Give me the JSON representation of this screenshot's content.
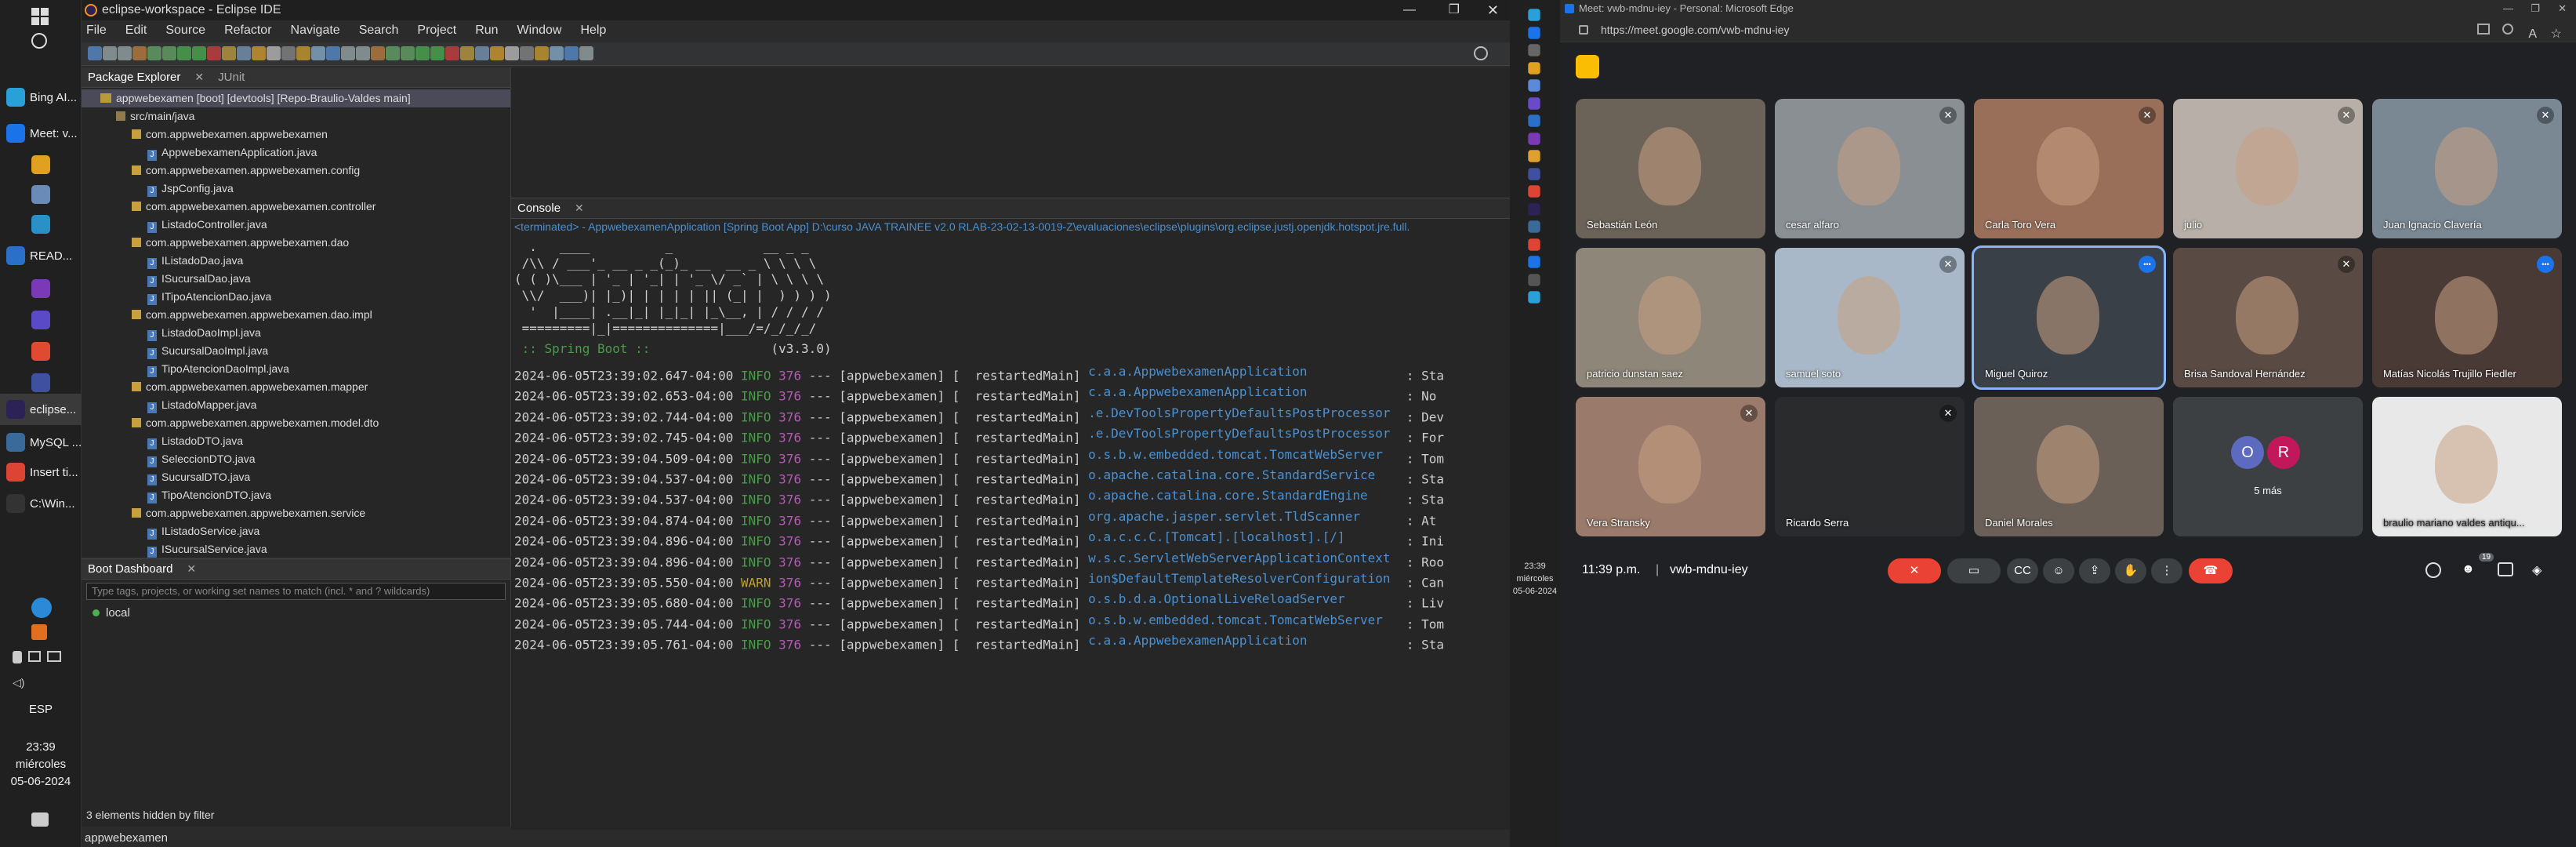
{
  "taskbar": {
    "items": [
      {
        "label": "Bing AI...",
        "color": "#2aa0d8"
      },
      {
        "label": "Meet: v...",
        "color": "#1a73e8"
      },
      {
        "label": "",
        "color": "#e0a020"
      },
      {
        "label": "",
        "color": "#6a8ab8"
      },
      {
        "label": "",
        "color": "#2a90c8"
      },
      {
        "label": "READ...",
        "color": "#2a70c8"
      },
      {
        "label": "",
        "color": "#7a3ab8"
      },
      {
        "label": "",
        "color": "#5a4ac8"
      },
      {
        "label": "",
        "color": "#e04a30"
      },
      {
        "label": "",
        "color": "#4050a0"
      },
      {
        "label": "eclipse...",
        "color": "#2c2255"
      },
      {
        "label": "MySQL ...",
        "color": "#3a6a9a"
      },
      {
        "label": "Insert ti...",
        "color": "#dd4433"
      },
      {
        "label": "C:\\Win...",
        "color": "#333333"
      }
    ],
    "language": "ESP",
    "time": "23:39",
    "day": "miércoles",
    "date": "05-06-2024"
  },
  "eclipse": {
    "window_title": "eclipse-workspace - Eclipse IDE",
    "menu": [
      "File",
      "Edit",
      "Source",
      "Refactor",
      "Navigate",
      "Search",
      "Project",
      "Run",
      "Window",
      "Help"
    ],
    "package_explorer": {
      "tab_label": "Package Explorer",
      "junit_tab": "JUnit",
      "tree": [
        {
          "text": "appwebexamen [boot] [devtools] [Repo-Braulio-Valdes main]",
          "level": 0,
          "kind": "pr"
        },
        {
          "text": "src/main/java",
          "level": 1,
          "kind": "sf"
        },
        {
          "text": "com.appwebexamen.appwebexamen",
          "level": 2,
          "kind": "pk"
        },
        {
          "text": "AppwebexamenApplication.java",
          "level": 3,
          "kind": "jf"
        },
        {
          "text": "com.appwebexamen.appwebexamen.config",
          "level": 2,
          "kind": "pk"
        },
        {
          "text": "JspConfig.java",
          "level": 3,
          "kind": "jf"
        },
        {
          "text": "com.appwebexamen.appwebexamen.controller",
          "level": 2,
          "kind": "pk"
        },
        {
          "text": "ListadoController.java",
          "level": 3,
          "kind": "jf"
        },
        {
          "text": "com.appwebexamen.appwebexamen.dao",
          "level": 2,
          "kind": "pk"
        },
        {
          "text": "IListadoDao.java",
          "level": 3,
          "kind": "jf"
        },
        {
          "text": "ISucursalDao.java",
          "level": 3,
          "kind": "jf"
        },
        {
          "text": "ITipoAtencionDao.java",
          "level": 3,
          "kind": "jf"
        },
        {
          "text": "com.appwebexamen.appwebexamen.dao.impl",
          "level": 2,
          "kind": "pk"
        },
        {
          "text": "ListadoDaoImpl.java",
          "level": 3,
          "kind": "jf"
        },
        {
          "text": "SucursalDaoImpl.java",
          "level": 3,
          "kind": "jf"
        },
        {
          "text": "TipoAtencionDaoImpl.java",
          "level": 3,
          "kind": "jf"
        },
        {
          "text": "com.appwebexamen.appwebexamen.mapper",
          "level": 2,
          "kind": "pk"
        },
        {
          "text": "ListadoMapper.java",
          "level": 3,
          "kind": "jf"
        },
        {
          "text": "com.appwebexamen.appwebexamen.model.dto",
          "level": 2,
          "kind": "pk"
        },
        {
          "text": "ListadoDTO.java",
          "level": 3,
          "kind": "jf"
        },
        {
          "text": "SeleccionDTO.java",
          "level": 3,
          "kind": "jf"
        },
        {
          "text": "SucursalDTO.java",
          "level": 3,
          "kind": "jf"
        },
        {
          "text": "TipoAtencionDTO.java",
          "level": 3,
          "kind": "jf"
        },
        {
          "text": "com.appwebexamen.appwebexamen.service",
          "level": 2,
          "kind": "pk"
        },
        {
          "text": "IListadoService.java",
          "level": 3,
          "kind": "jf"
        },
        {
          "text": "ISucursalService.java",
          "level": 3,
          "kind": "jf"
        }
      ]
    },
    "boot_dashboard": {
      "tab_label": "Boot Dashboard",
      "filter_placeholder": "Type tags, projects, or working set names to match (incl. * and ? wildcards)",
      "local": "local",
      "hidden_note": "3 elements hidden by filter"
    },
    "console": {
      "tab_label": "Console",
      "header": "<terminated> - AppwebexamenApplication [Spring Boot App] D:\\curso JAVA TRAINEE v2.0 RLAB-23-02-13-0019-Z\\evaluaciones\\eclipse\\plugins\\org.eclipse.justj.openjdk.hotspot.jre.full.",
      "banner": [
        "  .   ____          _            __ _ _",
        " /\\\\ / ___'_ __ _ _(_)_ __  __ _ \\ \\ \\ \\",
        "( ( )\\___ | '_ | '_| | '_ \\/ _` | \\ \\ \\ \\",
        " \\\\/  ___)| |_)| | | | | || (_| |  ) ) ) )",
        "  '  |____| .__|_| |_|_| |_\\__, | / / / /",
        " =========|_|==============|___/=/_/_/_/"
      ],
      "spring_label": " :: Spring Boot ::",
      "spring_version": "(v3.3.0)",
      "logs": [
        {
          "ts": "2024-06-05T23:39:02.647-04:00",
          "level": "INFO",
          "pid": "376",
          "thread": "[  restartedMain]",
          "logger": "c.a.a.AppwebexamenApplication",
          "msg": ": Sta"
        },
        {
          "ts": "2024-06-05T23:39:02.653-04:00",
          "level": "INFO",
          "pid": "376",
          "thread": "[  restartedMain]",
          "logger": "c.a.a.AppwebexamenApplication",
          "msg": ": No "
        },
        {
          "ts": "2024-06-05T23:39:02.744-04:00",
          "level": "INFO",
          "pid": "376",
          "thread": "[  restartedMain]",
          "logger": ".e.DevToolsPropertyDefaultsPostProcessor",
          "msg": ": Dev"
        },
        {
          "ts": "2024-06-05T23:39:02.745-04:00",
          "level": "INFO",
          "pid": "376",
          "thread": "[  restartedMain]",
          "logger": ".e.DevToolsPropertyDefaultsPostProcessor",
          "msg": ": For"
        },
        {
          "ts": "2024-06-05T23:39:04.509-04:00",
          "level": "INFO",
          "pid": "376",
          "thread": "[  restartedMain]",
          "logger": "o.s.b.w.embedded.tomcat.TomcatWebServer",
          "msg": ": Tom"
        },
        {
          "ts": "2024-06-05T23:39:04.537-04:00",
          "level": "INFO",
          "pid": "376",
          "thread": "[  restartedMain]",
          "logger": "o.apache.catalina.core.StandardService",
          "msg": ": Sta"
        },
        {
          "ts": "2024-06-05T23:39:04.537-04:00",
          "level": "INFO",
          "pid": "376",
          "thread": "[  restartedMain]",
          "logger": "o.apache.catalina.core.StandardEngine",
          "msg": ": Sta"
        },
        {
          "ts": "2024-06-05T23:39:04.874-04:00",
          "level": "INFO",
          "pid": "376",
          "thread": "[  restartedMain]",
          "logger": "org.apache.jasper.servlet.TldScanner",
          "msg": ": At "
        },
        {
          "ts": "2024-06-05T23:39:04.896-04:00",
          "level": "INFO",
          "pid": "376",
          "thread": "[  restartedMain]",
          "logger": "o.a.c.c.C.[Tomcat].[localhost].[/]",
          "msg": ": Ini"
        },
        {
          "ts": "2024-06-05T23:39:04.896-04:00",
          "level": "INFO",
          "pid": "376",
          "thread": "[  restartedMain]",
          "logger": "w.s.c.ServletWebServerApplicationContext",
          "msg": ": Roo"
        },
        {
          "ts": "2024-06-05T23:39:05.550-04:00",
          "level": "WARN",
          "pid": "376",
          "thread": "[  restartedMain]",
          "logger": "ion$DefaultTemplateResolverConfiguration",
          "msg": ": Can"
        },
        {
          "ts": "2024-06-05T23:39:05.680-04:00",
          "level": "INFO",
          "pid": "376",
          "thread": "[  restartedMain]",
          "logger": "o.s.b.d.a.OptionalLiveReloadServer",
          "msg": ": Liv"
        },
        {
          "ts": "2024-06-05T23:39:05.744-04:00",
          "level": "INFO",
          "pid": "376",
          "thread": "[  restartedMain]",
          "logger": "o.s.b.w.embedded.tomcat.TomcatWebServer",
          "msg": ": Tom"
        },
        {
          "ts": "2024-06-05T23:39:05.761-04:00",
          "level": "INFO",
          "pid": "376",
          "thread": "[  restartedMain]",
          "logger": "c.a.a.AppwebexamenApplication",
          "msg": ": Sta"
        }
      ],
      "app_tag": "[appwebexamen]"
    },
    "status": "appwebexamen"
  },
  "mid_clock": {
    "time": "23:39",
    "day": "miércoles",
    "date": "05-06-2024"
  },
  "edge": {
    "window_title": "Meet: vwb-mdnu-iey - Personal: Microsoft Edge",
    "url": "https://meet.google.com/vwb-mdnu-iey",
    "meet": {
      "participants": [
        {
          "name": "Sebastián León",
          "muted": false,
          "bg": "#6b6258"
        },
        {
          "name": "cesar alfaro",
          "muted": true,
          "bg": "#8a8f94"
        },
        {
          "name": "Carla Toro Vera",
          "muted": true,
          "bg": "#9a6f5a"
        },
        {
          "name": "julio",
          "muted": true,
          "bg": "#b8b0a8"
        },
        {
          "name": "Juan Ignacio Clavería",
          "muted": true,
          "bg": "#7a8894"
        },
        {
          "name": "patricio dunstan saez",
          "muted": false,
          "bg": "#8e8678"
        },
        {
          "name": "samuel soto",
          "muted": true,
          "bg": "#a8b8c8"
        },
        {
          "name": "Miguel Quiroz",
          "muted": false,
          "bg": "#3a4048",
          "speaking": true
        },
        {
          "name": "Brisa Sandoval Hernández",
          "muted": true,
          "bg": "#5a4a44"
        },
        {
          "name": "Matías Nicolás Trujillo Fiedler",
          "muted": false,
          "bg": "#4a3a36",
          "speaking": true
        },
        {
          "name": "Vera Stransky",
          "muted": true,
          "bg": "#9a7a6a"
        },
        {
          "name": "Ricardo Serra",
          "muted": true,
          "bg": "#2a2b2d"
        },
        {
          "name": "Daniel Morales",
          "muted": false,
          "bg": "#6a6058"
        },
        {
          "name": "5 más",
          "muted": false,
          "bg": "#3c4043",
          "avatars": [
            "O",
            "R"
          ]
        },
        {
          "name": "braulio mariano valdes antiqu...",
          "muted": false,
          "bg": "#e8e8e8"
        }
      ],
      "time": "11:39 p.m.",
      "code": "vwb-mdnu-iey",
      "participant_count": "19",
      "colors": {
        "end_call": "#ea4335",
        "mic_off": "#ea4335"
      }
    }
  }
}
